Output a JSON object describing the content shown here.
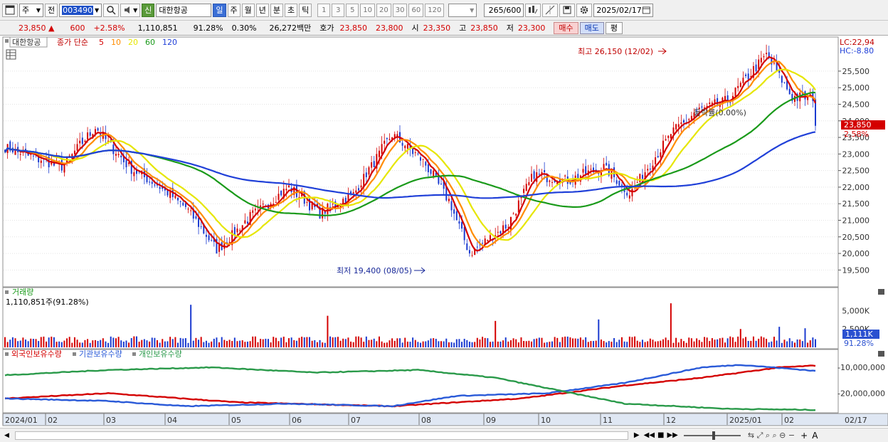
{
  "toolbar": {
    "market": "주",
    "prev_label": "전",
    "code": "003490",
    "new_badge": "신",
    "name": "대한항공",
    "periods": [
      "일",
      "주",
      "월",
      "년",
      "분",
      "초",
      "틱"
    ],
    "active_period": "일",
    "intervals": [
      "1",
      "3",
      "5",
      "10",
      "20",
      "30",
      "60",
      "120"
    ],
    "count": "265",
    "count_total": "/600",
    "date": "2025/02/17"
  },
  "quote": {
    "price": "23,850",
    "arrow": "▲",
    "change": "600",
    "change_pct": "+2.58%",
    "volume": "1,110,851",
    "vol_ratio": "91.28%",
    "turnover": "0.30%",
    "amount": "26,272백만",
    "hoga_label": "호가",
    "ask": "23,850",
    "bid": "23,800",
    "open_label": "시",
    "open": "23,350",
    "high_label": "고",
    "high": "23,850",
    "low_label": "저",
    "low": "23,300",
    "buy_label": "매수",
    "sell_label": "매도",
    "avg_label": "평"
  },
  "price_panel": {
    "name_tag": "대한항공",
    "ma_title": "종가 단순",
    "ma_periods": [
      "5",
      "10",
      "20",
      "60",
      "120"
    ],
    "ma_colors": [
      "#d40000",
      "#ff8c00",
      "#e6e600",
      "#1a9a1a",
      "#2040d8"
    ],
    "lc_label": "LC:22,94",
    "hc_label": "HC:-8.80",
    "current_tag": "23,850",
    "current_pct": "2.58%",
    "max_label": "최고 26,150 (12/02)",
    "min_label": "최저 19,400 (08/05)",
    "ratio_label": "등락률(0.00%)"
  },
  "volume_panel": {
    "title": "거래량",
    "info": "1,110,851주(91.28%)",
    "current_tag": "1,111K",
    "current_pct": "91.28%"
  },
  "holdings_panel": {
    "labels": [
      "외국인보유수량",
      "기관보유수량",
      "개인보유수량"
    ],
    "colors": [
      "#d40000",
      "#2a5ad8",
      "#2a9a4a"
    ]
  },
  "axis": {
    "x_labels": [
      "2024/01",
      "02",
      "03",
      "04",
      "05",
      "06",
      "07",
      "08",
      "09",
      "10",
      "11",
      "12",
      "2025/01",
      "02",
      "02/17"
    ]
  },
  "chart_data": {
    "type": "candlestick",
    "price": {
      "y_ticks": [
        19500,
        20000,
        20500,
        21000,
        21500,
        22000,
        22500,
        23000,
        23500,
        24000,
        24500,
        25000,
        25500
      ],
      "ylim": [
        19100,
        26400
      ],
      "anchors_x": [
        0,
        22,
        35,
        48,
        60,
        70,
        82,
        95,
        110,
        122,
        135,
        150,
        162,
        172,
        180,
        195,
        205,
        218,
        232,
        242,
        258,
        268,
        280,
        295,
        305,
        314
      ],
      "anchors_close": [
        23200,
        22600,
        23800,
        22600,
        22000,
        21400,
        20100,
        21100,
        22000,
        21200,
        21800,
        23600,
        22800,
        21600,
        20000,
        20900,
        22400,
        22200,
        22600,
        21800,
        23600,
        24300,
        24600,
        26000,
        24700,
        24700
      ],
      "close_last": 23850
    },
    "volume": {
      "y_ticks": [
        "2,500K",
        "5,000K"
      ],
      "ymax": 6400000
    },
    "holdings": {
      "y_ticks": [
        "-10,000,000",
        "-20,000,000"
      ],
      "ylim": [
        -27000000,
        -5000000
      ],
      "foreign": [
        [
          0,
          -22000000
        ],
        [
          40,
          -20000000
        ],
        [
          90,
          -23500000
        ],
        [
          150,
          -25000000
        ],
        [
          200,
          -22000000
        ],
        [
          240,
          -17000000
        ],
        [
          270,
          -14000000
        ],
        [
          300,
          -10000000
        ],
        [
          320,
          -9000000
        ]
      ],
      "institution": [
        [
          0,
          -22000000
        ],
        [
          40,
          -23000000
        ],
        [
          70,
          -25000000
        ],
        [
          110,
          -24000000
        ],
        [
          150,
          -25000000
        ],
        [
          175,
          -21000000
        ],
        [
          210,
          -20000000
        ],
        [
          240,
          -16000000
        ],
        [
          270,
          -10000000
        ],
        [
          285,
          -9000000
        ],
        [
          310,
          -11000000
        ],
        [
          320,
          -12000000
        ]
      ],
      "individual": [
        [
          0,
          -13000000
        ],
        [
          40,
          -11000000
        ],
        [
          80,
          -10000000
        ],
        [
          120,
          -12000000
        ],
        [
          160,
          -11000000
        ],
        [
          190,
          -14000000
        ],
        [
          215,
          -19000000
        ],
        [
          240,
          -24000000
        ],
        [
          280,
          -26000000
        ],
        [
          320,
          -26500000
        ]
      ]
    }
  }
}
